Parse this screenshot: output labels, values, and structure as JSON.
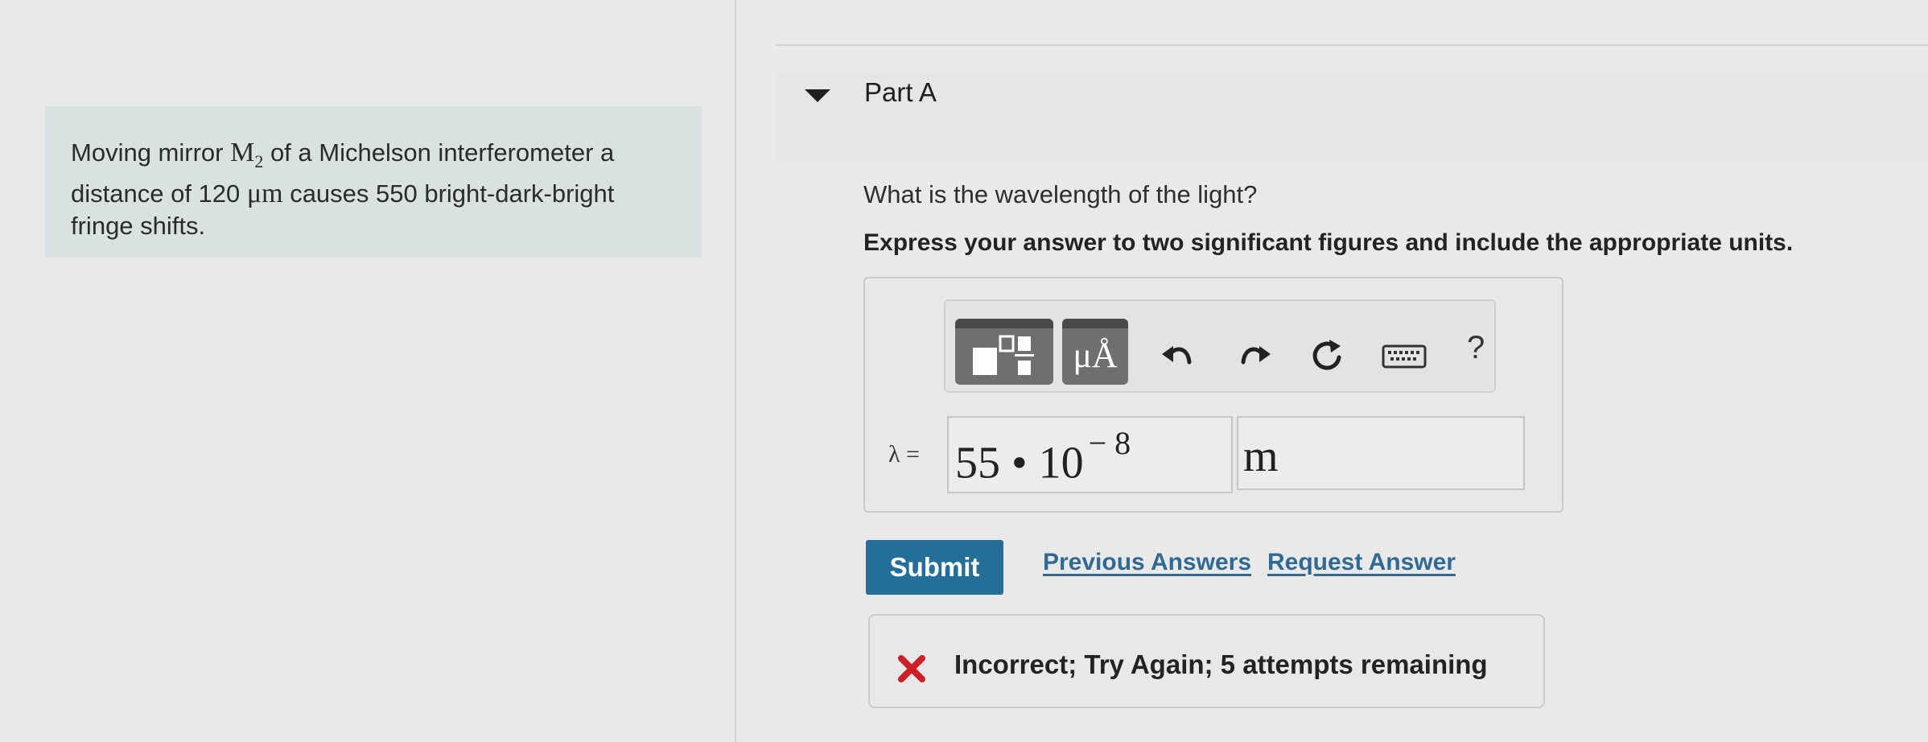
{
  "problem": {
    "text_part1": "Moving mirror ",
    "mirror_symbol": "M",
    "mirror_subscript": "2",
    "text_part2": " of a Michelson interferometer a distance of 120 ",
    "unit_symbol": "μm",
    "text_part3": " causes 550 bright-dark-bright fringe shifts."
  },
  "part": {
    "title": "Part A",
    "question": "What is the wavelength of the light?",
    "instruction": "Express your answer to two significant figures and include the appropriate units."
  },
  "toolbar": {
    "tools": [
      "templates-icon",
      "units-icon",
      "undo-icon",
      "redo-icon",
      "reset-icon",
      "keyboard-icon",
      "help-icon"
    ],
    "units_glyph": "μÅ",
    "help_glyph": "?"
  },
  "answer": {
    "label": "λ =",
    "value_mantissa": "55 • 10",
    "value_exponent": "− 8",
    "unit": "m"
  },
  "actions": {
    "submit_label": "Submit",
    "previous_answers_label": "Previous Answers",
    "request_answer_label": "Request Answer"
  },
  "feedback": {
    "message": "Incorrect; Try Again; 5 attempts remaining",
    "status_color": "#cc2027"
  },
  "colors": {
    "accent": "#246f9a",
    "link": "#2f6a94",
    "problem_bg": "#d9e2e0"
  }
}
